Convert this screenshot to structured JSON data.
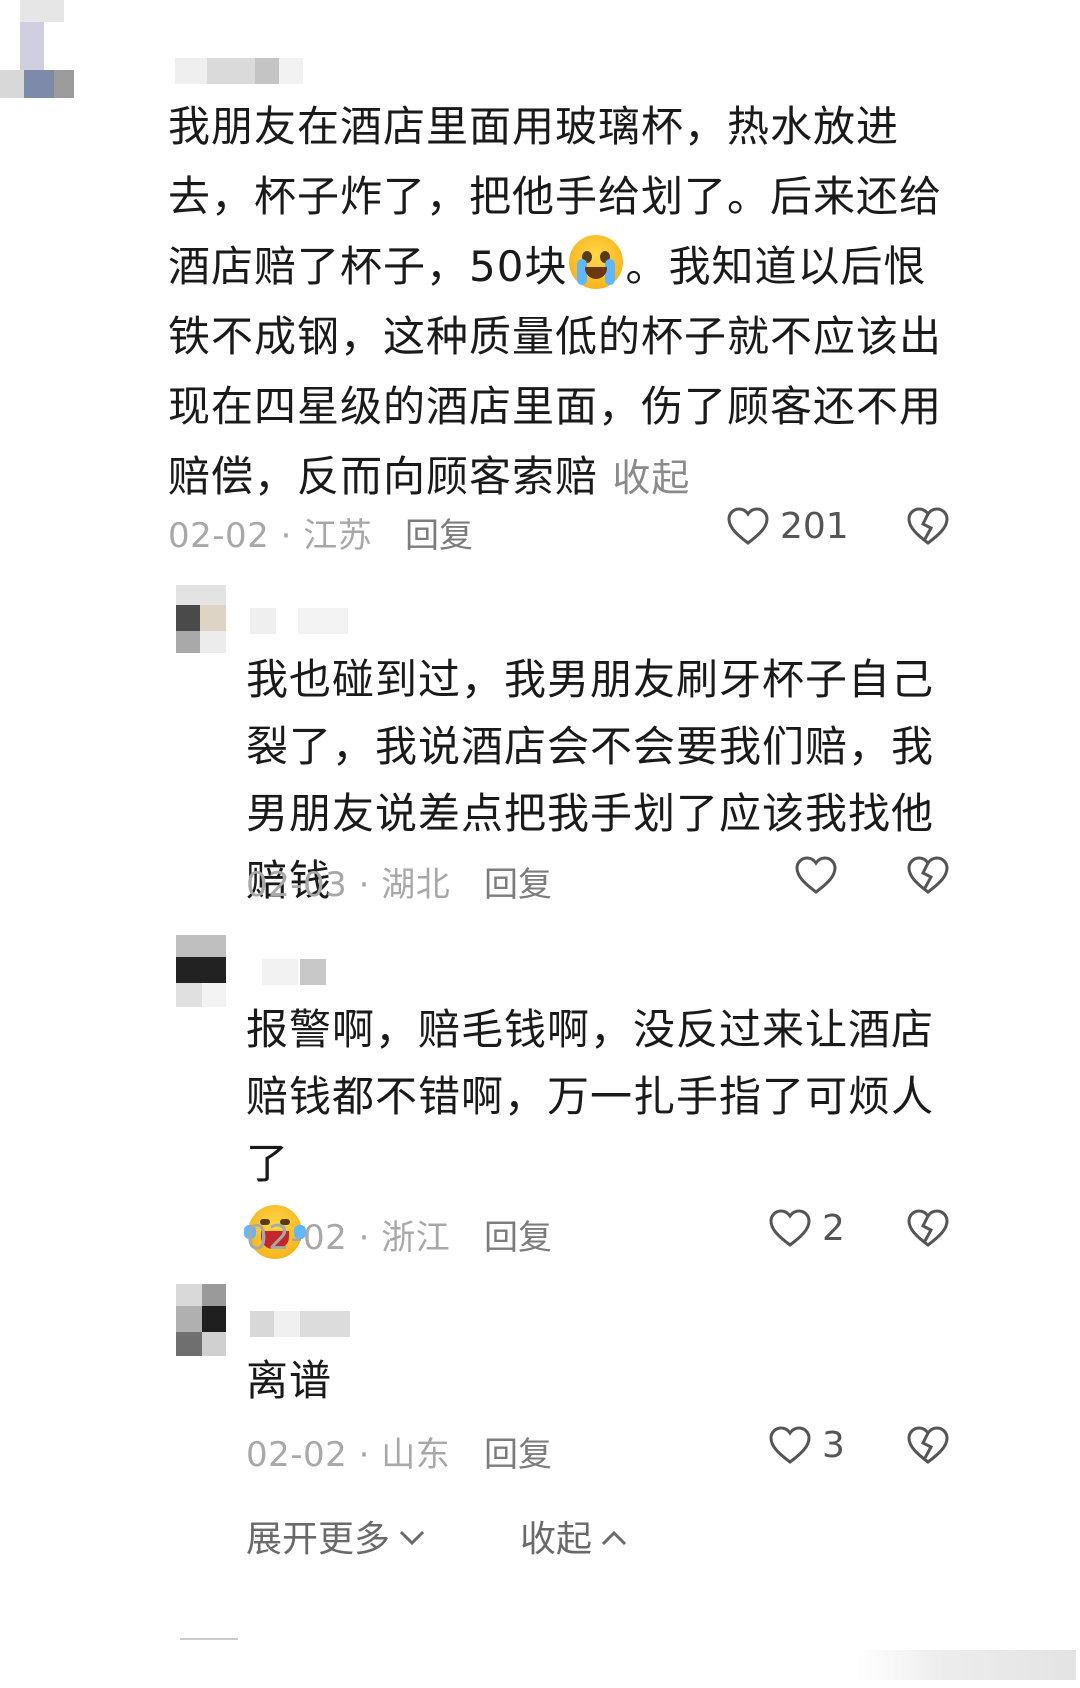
{
  "comments": [
    {
      "text_before_emoji": "我朋友在酒店里面用玻璃杯，热水放进去，杯子炸了，把他手给划了。后来还给酒店赔了杯子，50块",
      "text_after_emoji": "。我知道以后恨铁不成钢，这种质量低的杯子就不应该出现在四星级的酒店里面，伤了顾客还不用赔偿，反而向顾客索赔",
      "collapse_label": "收起",
      "date": "02-02",
      "location": "江苏",
      "reply_label": "回复",
      "likes": "201"
    }
  ],
  "replies": [
    {
      "text": "我也碰到过，我男朋友刷牙杯子自己裂了，我说酒店会不会要我们赔，我男朋友说差点把我手划了应该我找他赔钱",
      "date": "02-03",
      "location": "湖北",
      "reply_label": "回复",
      "likes": ""
    },
    {
      "text": "报警啊，赔毛钱啊，没反过来让酒店赔钱都不错啊，万一扎手指了可烦人了",
      "date": "02-02",
      "location": "浙江",
      "reply_label": "回复",
      "likes": "2"
    },
    {
      "text": "离谱",
      "date": "02-02",
      "location": "山东",
      "reply_label": "回复",
      "likes": "3"
    }
  ],
  "meta_separator": " · ",
  "footer": {
    "expand_label": "展开更多",
    "collapse_label": "收起"
  },
  "icons": {
    "like": "heart-outline-icon",
    "dislike": "broken-heart-icon",
    "emoji_1": "crying-face-emoji",
    "emoji_2": "laughing-tears-emoji",
    "expand": "chevron-down-icon",
    "collapse": "chevron-up-icon"
  },
  "colors": {
    "text": "#1a1a1a",
    "meta": "#a8a8a8",
    "action": "#7c7c7c",
    "background": "#ffffff"
  }
}
